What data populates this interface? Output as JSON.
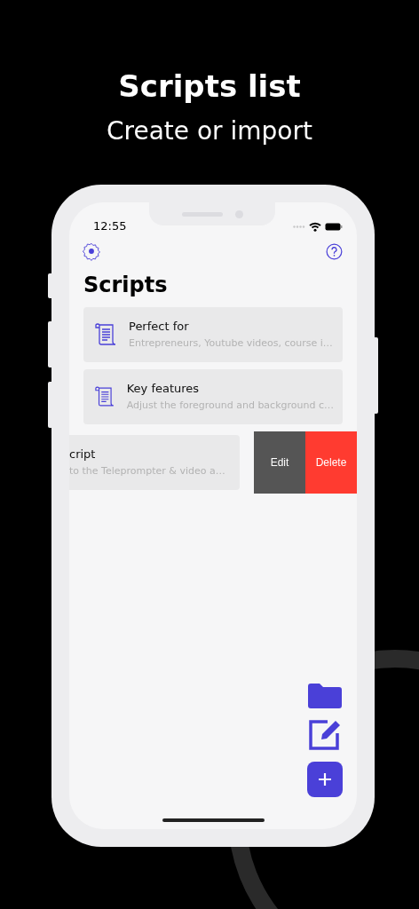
{
  "header": {
    "title": "Scripts list",
    "subtitle": "Create or import"
  },
  "status_bar": {
    "time": "12:55"
  },
  "screen": {
    "title": "Scripts"
  },
  "scripts": [
    {
      "title": "Perfect for",
      "preview": "Entrepreneurs, Youtube videos, course i…",
      "swiped": false
    },
    {
      "title": "Key features",
      "preview": "Adjust the foreground and background c…",
      "swiped": false
    },
    {
      "title": "cript",
      "preview": "to the Teleprompter & video a…",
      "swiped": true
    }
  ],
  "row_actions": [
    {
      "label": "Edit",
      "kind": "edit"
    },
    {
      "label": "Delete",
      "kind": "delete"
    }
  ]
}
